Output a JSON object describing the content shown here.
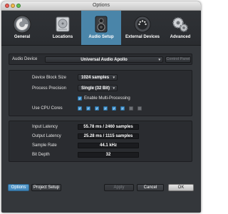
{
  "window": {
    "title": "Options"
  },
  "tabs": [
    {
      "label": "General",
      "icon": "gear-icon"
    },
    {
      "label": "Locations",
      "icon": "hard-drive-icon"
    },
    {
      "label": "Audio Setup",
      "icon": "speaker-icon"
    },
    {
      "label": "External Devices",
      "icon": "midi-connector-icon"
    },
    {
      "label": "Advanced",
      "icon": "cogs-icon"
    }
  ],
  "active_tab": "Audio Setup",
  "audio_device": {
    "label": "Audio Device",
    "value": "Universal Audio Apollo",
    "control_panel_label": "Control Panel"
  },
  "settings": {
    "device_block_size": {
      "label": "Device Block Size",
      "value": "1024 samples"
    },
    "process_precision": {
      "label": "Process Precision",
      "value": "Single (32 Bit)"
    },
    "multi_processing": {
      "label": "Enable Multi-Processing",
      "checked": true
    },
    "cpu_cores": {
      "label": "Use CPU Cores",
      "states": [
        true,
        true,
        true,
        true,
        true,
        true,
        false,
        false
      ]
    }
  },
  "info": {
    "input_latency": {
      "label": "Input Latency",
      "value": "55.78 ms / 2460 samples"
    },
    "output_latency": {
      "label": "Output Latency",
      "value": "25.28 ms / 1115 samples"
    },
    "sample_rate": {
      "label": "Sample Rate",
      "value": "44.1 kHz"
    },
    "bit_depth": {
      "label": "Bit Depth",
      "value": "32"
    }
  },
  "footer": {
    "options": "Options",
    "project_setup": "Project Setup",
    "apply": "Apply",
    "cancel": "Cancel",
    "ok": "OK"
  },
  "colors": {
    "active_tab": "#4a85a9",
    "window_bg": "#34373b",
    "checkbox_on": "#4d9bd6"
  }
}
